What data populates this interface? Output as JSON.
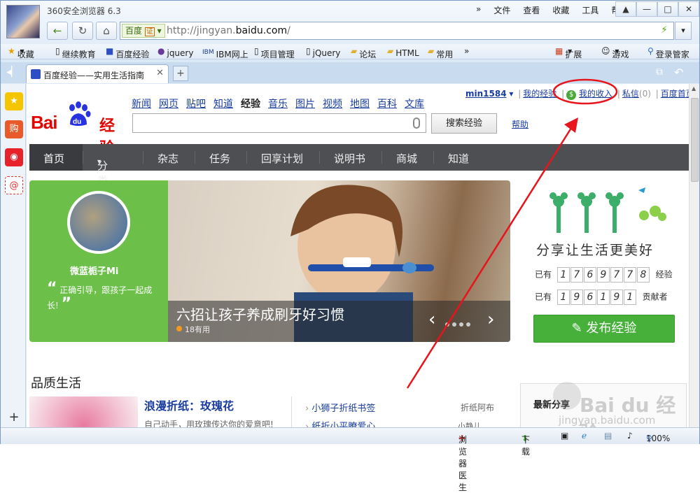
{
  "browser": {
    "title": "360安全浏览器 6.3",
    "menu": [
      "文件",
      "查看",
      "收藏",
      "工具",
      "帮助"
    ],
    "address": {
      "engine": "百度",
      "badge": "证",
      "url_prefix": "http://jingyan.",
      "url_domain": "baidu.com",
      "url_suffix": "/"
    },
    "bookmarks": [
      {
        "label": "收藏",
        "icon": "star-icon"
      },
      {
        "label": "继续教育",
        "icon": "page-icon"
      },
      {
        "label": "百度经验",
        "icon": "baidu-paw-icon"
      },
      {
        "label": "jquery",
        "icon": "page-icon"
      },
      {
        "label": "IBM网上",
        "icon": "ibm-icon"
      },
      {
        "label": "项目管理",
        "icon": "page-icon"
      },
      {
        "label": "jQuery",
        "icon": "page-icon"
      },
      {
        "label": "论坛",
        "icon": "folder-icon"
      },
      {
        "label": "HTML",
        "icon": "folder-icon"
      },
      {
        "label": "常用",
        "icon": "folder-icon"
      }
    ],
    "extensions": {
      "ext": "扩展",
      "games": "游戏",
      "login": "登录管家"
    },
    "tab": {
      "title": "百度经验——实用生活指南"
    },
    "status": {
      "doctor": "浏览器医生",
      "download": "下载",
      "zoom": "100%"
    }
  },
  "page": {
    "user": {
      "name": "min1584",
      "my_exp": "我的经验",
      "my_income": "我的收入",
      "msg": "私信",
      "msg_count": "(0)",
      "home": "百度首页"
    },
    "logo": {
      "bai": "Bai",
      "du": "du",
      "jy": "经验"
    },
    "nav_links": [
      "新闻",
      "网页",
      "贴吧",
      "知道",
      "经验",
      "音乐",
      "图片",
      "视频",
      "地图",
      "百科",
      "文库"
    ],
    "search_button": "搜索经验",
    "help": "帮助",
    "main_nav": [
      "首页",
      "分类",
      "杂志",
      "任务",
      "回享计划",
      "说明书",
      "商城",
      "知道"
    ],
    "slider": {
      "user_name": "微蓝栀子Mi",
      "quote": "正确引导，跟孩子一起成长!",
      "caption": "六招让孩子养成刷牙好习惯",
      "useful": "18有用"
    },
    "right": {
      "slogan": "分享让生活更美好",
      "row1_prefix": "已有",
      "row1_digits": [
        "1",
        "7",
        "6",
        "9",
        "7",
        "7",
        "8"
      ],
      "row1_suffix": "经验",
      "row2_prefix": "已有",
      "row2_digits": [
        "1",
        "9",
        "6",
        "1",
        "9",
        "1"
      ],
      "row2_suffix": "贡献者",
      "publish": "发布经验"
    },
    "section": {
      "title": "品质生活",
      "feature_title": "浪漫折纸：玫瑰花",
      "feature_desc": "自己动手，用玫瑰传达你的爱意吧!",
      "list": [
        "小狮子折纸书签",
        "纸折小平瞭爱心"
      ],
      "tags": [
        "折纸阿布",
        "小静儿"
      ],
      "latest": "最新分享"
    },
    "watermark": {
      "brand": "Bai du 经验",
      "url": "jingyan.baidu.com"
    }
  },
  "colors": {
    "accent_red": "#e10602",
    "link": "#1a3d9f",
    "green": "#46b03a",
    "nav_bg": "#4e4f53"
  }
}
